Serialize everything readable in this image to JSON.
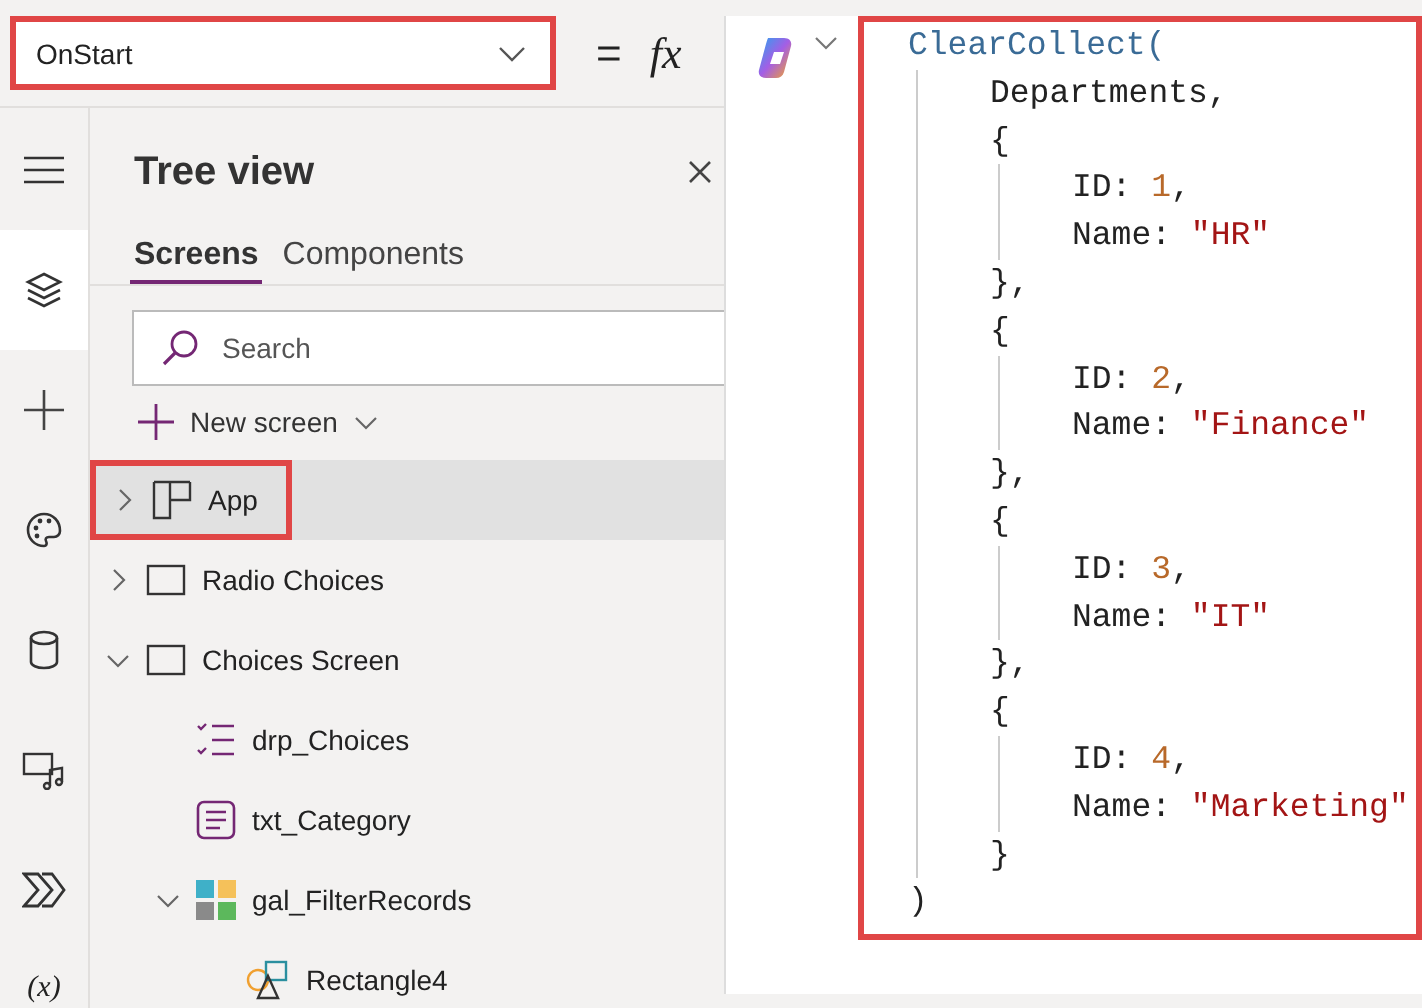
{
  "property_dropdown": {
    "value": "OnStart",
    "highlighted": true
  },
  "formula_bar": {
    "equals": "=",
    "fx": "fx"
  },
  "rail": [
    {
      "kind": "menu",
      "selected": false
    },
    {
      "kind": "layers",
      "selected": true
    },
    {
      "kind": "insert",
      "selected": false
    },
    {
      "kind": "theme",
      "selected": false
    },
    {
      "kind": "data",
      "selected": false
    },
    {
      "kind": "media",
      "selected": false
    },
    {
      "kind": "automate",
      "selected": false
    },
    {
      "kind": "variables",
      "selected": false,
      "glyph": "(x)"
    }
  ],
  "tree_view": {
    "title": "Tree view",
    "tabs": [
      {
        "label": "Screens",
        "selected": true
      },
      {
        "label": "Components",
        "selected": false
      }
    ],
    "search": {
      "placeholder": "Search"
    },
    "new_screen": "New screen",
    "items": [
      {
        "label": "App",
        "kind": "app",
        "expanded": false,
        "selected": true,
        "highlighted": true
      },
      {
        "label": "Radio Choices",
        "kind": "screen",
        "expanded": false,
        "selected": false,
        "highlighted": false
      },
      {
        "label": "Choices Screen",
        "kind": "screen",
        "expanded": true,
        "selected": false,
        "highlighted": false,
        "children": [
          {
            "label": "drp_Choices",
            "kind": "dropdown",
            "selected": false,
            "highlighted": false
          },
          {
            "label": "txt_Category",
            "kind": "text",
            "selected": false,
            "highlighted": false
          },
          {
            "label": "gal_FilterRecords",
            "kind": "gallery",
            "expanded": true,
            "selected": false,
            "highlighted": false,
            "children": [
              {
                "label": "Rectangle4",
                "kind": "shapes",
                "selected": false,
                "highlighted": false
              }
            ]
          }
        ]
      }
    ]
  },
  "code_editor": {
    "highlighted": true,
    "lines": [
      {
        "tokens": [
          {
            "text": "ClearCollect(",
            "kind": "function"
          }
        ],
        "children": [
          {
            "tokens": [
              {
                "text": "Departments,",
                "kind": "plain"
              }
            ]
          },
          {
            "tokens": [
              {
                "text": "{",
                "kind": "plain"
              }
            ],
            "children": [
              {
                "tokens": [
                  {
                    "text": "ID: ",
                    "kind": "plain"
                  },
                  {
                    "text": "1",
                    "kind": "number"
                  },
                  {
                    "text": ",",
                    "kind": "plain"
                  }
                ]
              },
              {
                "tokens": [
                  {
                    "text": "Name: ",
                    "kind": "plain"
                  },
                  {
                    "text": "\"HR\"",
                    "kind": "string"
                  }
                ]
              }
            ]
          },
          {
            "tokens": [
              {
                "text": "},",
                "kind": "plain"
              }
            ]
          },
          {
            "tokens": [
              {
                "text": "{",
                "kind": "plain"
              }
            ],
            "children": [
              {
                "tokens": [
                  {
                    "text": "ID: ",
                    "kind": "plain"
                  },
                  {
                    "text": "2",
                    "kind": "number"
                  },
                  {
                    "text": ",",
                    "kind": "plain"
                  }
                ]
              },
              {
                "tokens": [
                  {
                    "text": "Name: ",
                    "kind": "plain"
                  },
                  {
                    "text": "\"Finance\"",
                    "kind": "string"
                  }
                ]
              }
            ]
          },
          {
            "tokens": [
              {
                "text": "},",
                "kind": "plain"
              }
            ]
          },
          {
            "tokens": [
              {
                "text": "{",
                "kind": "plain"
              }
            ],
            "children": [
              {
                "tokens": [
                  {
                    "text": "ID: ",
                    "kind": "plain"
                  },
                  {
                    "text": "3",
                    "kind": "number"
                  },
                  {
                    "text": ",",
                    "kind": "plain"
                  }
                ]
              },
              {
                "tokens": [
                  {
                    "text": "Name: ",
                    "kind": "plain"
                  },
                  {
                    "text": "\"IT\"",
                    "kind": "string"
                  }
                ]
              }
            ]
          },
          {
            "tokens": [
              {
                "text": "},",
                "kind": "plain"
              }
            ]
          },
          {
            "tokens": [
              {
                "text": "{",
                "kind": "plain"
              }
            ],
            "children": [
              {
                "tokens": [
                  {
                    "text": "ID: ",
                    "kind": "plain"
                  },
                  {
                    "text": "4",
                    "kind": "number"
                  },
                  {
                    "text": ",",
                    "kind": "plain"
                  }
                ]
              },
              {
                "tokens": [
                  {
                    "text": "Name: ",
                    "kind": "plain"
                  },
                  {
                    "text": "\"Marketing\"",
                    "kind": "string"
                  }
                ]
              }
            ]
          },
          {
            "tokens": [
              {
                "text": "}",
                "kind": "plain"
              }
            ]
          }
        ]
      },
      {
        "tokens": [
          {
            "text": ")",
            "kind": "plain"
          }
        ]
      }
    ]
  }
}
